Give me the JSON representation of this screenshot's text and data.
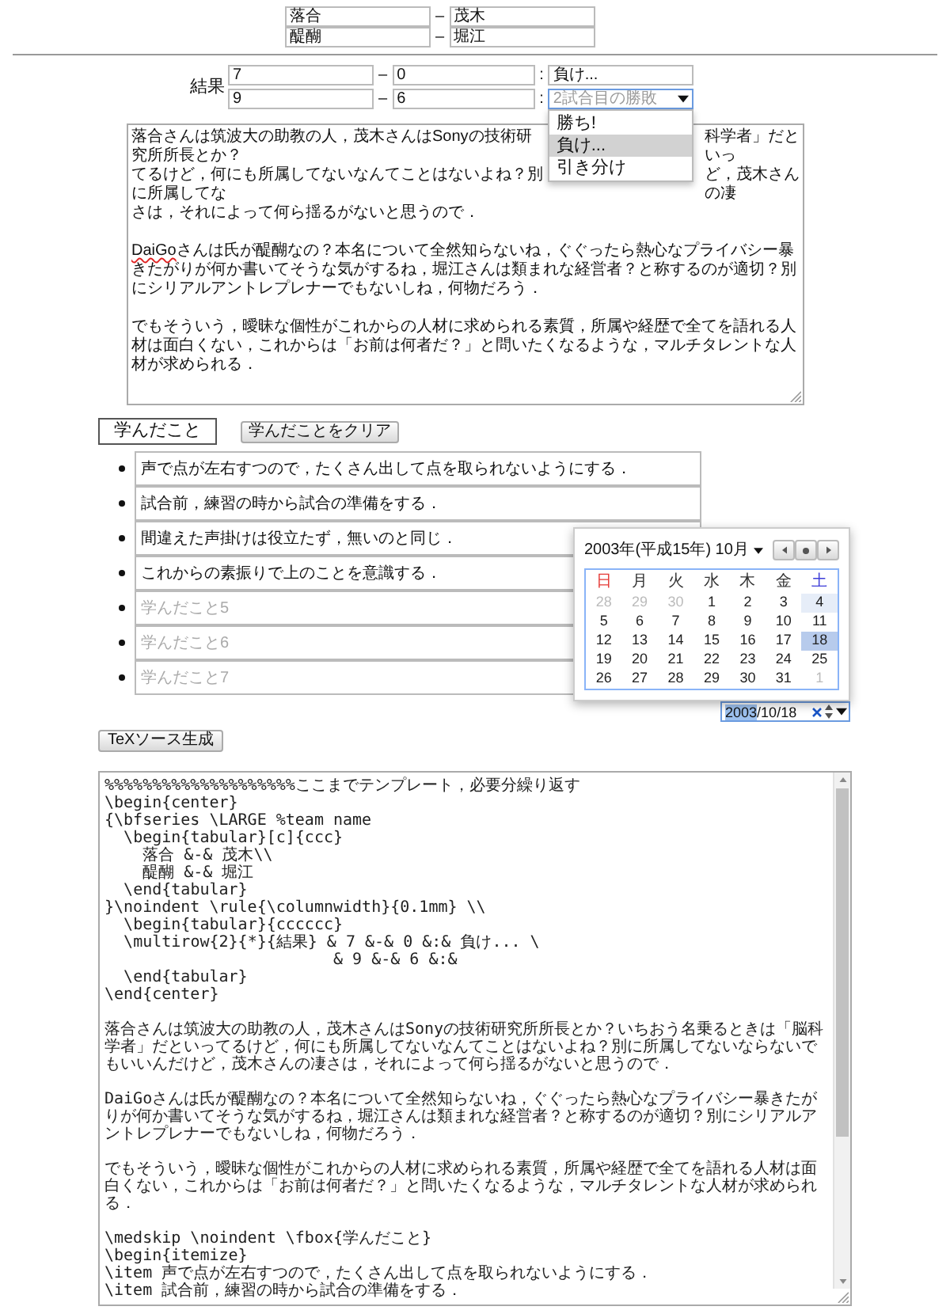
{
  "teams": [
    {
      "left": "落合",
      "dash": "–",
      "right": "茂木"
    },
    {
      "left": "醍醐",
      "dash": "–",
      "right": "堀江"
    }
  ],
  "result": {
    "label": "結果",
    "rows": [
      {
        "score_a": "7",
        "dash": "–",
        "score_b": "0",
        "colon": ":",
        "outcome": {
          "value": "負け...",
          "focused": false
        }
      },
      {
        "score_a": "9",
        "dash": "–",
        "score_b": "6",
        "colon": ":",
        "outcome": {
          "placeholder": "2試合目の勝敗",
          "focused": true,
          "menu": [
            {
              "label": "勝ち!",
              "selected": false
            },
            {
              "label": "負け...",
              "selected": true
            },
            {
              "label": "引き分け",
              "selected": false
            }
          ]
        }
      }
    ]
  },
  "memo": {
    "covered_parts": [
      "落合さんは筑波大の助教の人，茂木さんはSonyの技術研究所所長とか？",
      "科学者」だといっ",
      "てるけど，何にも所属してないなんてことはないよね？別に所属してな",
      "ど，茂木さんの凄",
      "さは，それによって何ら揺るがないと思うので．"
    ],
    "paragraphs": [
      [
        {
          "text": "DaiGo",
          "misspelled": true
        },
        {
          "text": "さんは氏が醍醐なの？本名について全然知らないね，ぐぐったら熱心なプライバシー暴きたがりが何か書いてそうな気がするね，堀江さんは類まれな経営者？と称するのが適切？別にシリアルアントレプレナーでもないしね，何物だろう．",
          "misspelled": false
        }
      ],
      [
        {
          "text": "でもそういう，曖昧な個性がこれからの人材に求められる素質，所属や経歴で全てを語れる人材は面白くない，これからは「お前は何者だ？」と問いたくなるような，マルチタレントな人材が求められる．",
          "misspelled": false
        }
      ]
    ]
  },
  "learned": {
    "heading": "学んだこと",
    "clear_button": "学んだことをクリア",
    "items": [
      {
        "value": "声で点が左右すつので，たくさん出して点を取られないようにする．"
      },
      {
        "value": "試合前，練習の時から試合の準備をする．"
      },
      {
        "value": "間違えた声掛けは役立たず，無いのと同じ．"
      },
      {
        "value": "これからの素振りで上のことを意識する．"
      },
      {
        "placeholder": "学んだこと5"
      },
      {
        "placeholder": "学んだこと6"
      },
      {
        "placeholder": "学んだこと7"
      }
    ]
  },
  "calendar": {
    "title": "2003年(平成15年) 10月",
    "weekdays": [
      {
        "label": "日",
        "color": "#e53935"
      },
      {
        "label": "月",
        "color": "#333333"
      },
      {
        "label": "火",
        "color": "#333333"
      },
      {
        "label": "水",
        "color": "#333333"
      },
      {
        "label": "木",
        "color": "#333333"
      },
      {
        "label": "金",
        "color": "#333333"
      },
      {
        "label": "土",
        "color": "#3d3dd8"
      }
    ],
    "weeks": [
      [
        {
          "day": "28",
          "outside": true,
          "highlighted": false,
          "selected": false
        },
        {
          "day": "29",
          "outside": true,
          "highlighted": false,
          "selected": false
        },
        {
          "day": "30",
          "outside": true,
          "highlighted": false,
          "selected": false
        },
        {
          "day": "1",
          "outside": false,
          "highlighted": false,
          "selected": false
        },
        {
          "day": "2",
          "outside": false,
          "highlighted": false,
          "selected": false
        },
        {
          "day": "3",
          "outside": false,
          "highlighted": false,
          "selected": false
        },
        {
          "day": "4",
          "outside": false,
          "highlighted": true,
          "selected": false
        }
      ],
      [
        {
          "day": "5",
          "outside": false,
          "highlighted": false,
          "selected": false
        },
        {
          "day": "6",
          "outside": false,
          "highlighted": false,
          "selected": false
        },
        {
          "day": "7",
          "outside": false,
          "highlighted": false,
          "selected": false
        },
        {
          "day": "8",
          "outside": false,
          "highlighted": false,
          "selected": false
        },
        {
          "day": "9",
          "outside": false,
          "highlighted": false,
          "selected": false
        },
        {
          "day": "10",
          "outside": false,
          "highlighted": false,
          "selected": false
        },
        {
          "day": "11",
          "outside": false,
          "highlighted": false,
          "selected": false
        }
      ],
      [
        {
          "day": "12",
          "outside": false,
          "highlighted": false,
          "selected": false
        },
        {
          "day": "13",
          "outside": false,
          "highlighted": false,
          "selected": false
        },
        {
          "day": "14",
          "outside": false,
          "highlighted": false,
          "selected": false
        },
        {
          "day": "15",
          "outside": false,
          "highlighted": false,
          "selected": false
        },
        {
          "day": "16",
          "outside": false,
          "highlighted": false,
          "selected": false
        },
        {
          "day": "17",
          "outside": false,
          "highlighted": false,
          "selected": false
        },
        {
          "day": "18",
          "outside": false,
          "highlighted": false,
          "selected": true
        }
      ],
      [
        {
          "day": "19",
          "outside": false,
          "highlighted": false,
          "selected": false
        },
        {
          "day": "20",
          "outside": false,
          "highlighted": false,
          "selected": false
        },
        {
          "day": "21",
          "outside": false,
          "highlighted": false,
          "selected": false
        },
        {
          "day": "22",
          "outside": false,
          "highlighted": false,
          "selected": false
        },
        {
          "day": "23",
          "outside": false,
          "highlighted": false,
          "selected": false
        },
        {
          "day": "24",
          "outside": false,
          "highlighted": false,
          "selected": false
        },
        {
          "day": "25",
          "outside": false,
          "highlighted": false,
          "selected": false
        }
      ],
      [
        {
          "day": "26",
          "outside": false,
          "highlighted": false,
          "selected": false
        },
        {
          "day": "27",
          "outside": false,
          "highlighted": false,
          "selected": false
        },
        {
          "day": "28",
          "outside": false,
          "highlighted": false,
          "selected": false
        },
        {
          "day": "29",
          "outside": false,
          "highlighted": false,
          "selected": false
        },
        {
          "day": "30",
          "outside": false,
          "highlighted": false,
          "selected": false
        },
        {
          "day": "31",
          "outside": false,
          "highlighted": false,
          "selected": false
        },
        {
          "day": "1",
          "outside": true,
          "highlighted": false,
          "selected": false
        }
      ]
    ]
  },
  "date_field": {
    "parts": [
      {
        "text": "2003",
        "selected": true
      },
      {
        "text": "/",
        "selected": false
      },
      {
        "text": "10",
        "selected": false
      },
      {
        "text": "/",
        "selected": false
      },
      {
        "text": "18",
        "selected": false
      }
    ]
  },
  "generate_button": "TeXソース生成",
  "tex_source": {
    "blocks": [
      {
        "lines": [
          "%%%%%%%%%%%%%%%%%%%%ここまでテンプレート，必要分繰り返す",
          "\\begin{center}",
          "{\\bfseries \\LARGE %team name",
          "  \\begin{tabular}[c]{ccc}",
          "    落合 &-& 茂木\\\\",
          "    醍醐 &-& 堀江",
          "  \\end{tabular}",
          "}\\noindent \\rule{\\columnwidth}{0.1mm} \\\\",
          "  \\begin{tabular}{cccccc}",
          "  \\multirow{2}{*}{結果} & 7 &-& 0 &:& 負け... \\",
          "                        & 9 &-& 6 &:&",
          "  \\end{tabular}",
          "\\end{center}"
        ]
      },
      {
        "lines": [
          "落合さんは筑波大の助教の人，茂木さんはSonyの技術研究所所長とか？いちおう名乗るときは「脳科学者」だといってるけど，何にも所属してないなんてことはないよね？別に所属してないならないでもいいんだけど，茂木さんの凄さは，それによって何ら揺るがないと思うので．"
        ]
      },
      {
        "lines": [
          "DaiGoさんは氏が醍醐なの？本名について全然知らないね，ぐぐったら熱心なプライバシー暴きたがりが何か書いてそうな気がするね，堀江さんは類まれな経営者？と称するのが適切？別にシリアルアントレプレナーでもないしね，何物だろう．"
        ]
      },
      {
        "lines": [
          "でもそういう，曖昧な個性がこれからの人材に求められる素質，所属や経歴で全てを語れる人材は面白くない，これからは「お前は何者だ？」と問いたくなるような，マルチタレントな人材が求められる．"
        ]
      },
      {
        "lines": [
          "\\medskip \\noindent \\fbox{学んだこと}",
          "\\begin{itemize}",
          "\\item 声で点が左右すつので，たくさん出して点を取られないようにする．",
          "\\item 試合前，練習の時から試合の準備をする．"
        ]
      }
    ]
  }
}
